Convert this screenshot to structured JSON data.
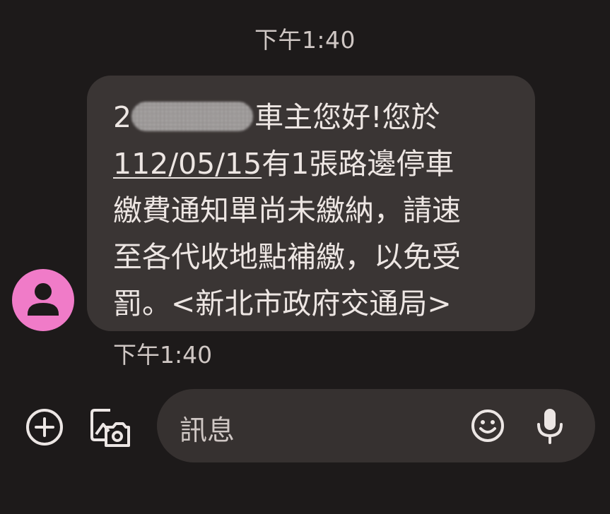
{
  "conversation": {
    "header_time": "下午1:40"
  },
  "contact": {
    "avatar_icon": "person-icon",
    "avatar_color": "#f07bc8"
  },
  "message": {
    "line1_prefix": "2",
    "line1_suffix": "車主您好!您於",
    "line2_link": "112/05/15",
    "line2_rest": "有1張路邊停車",
    "line3": "繳費通知單尚未繳納，請速",
    "line4": "至各代收地點補繳，以免受",
    "line5": "罰。<新北市政府交通局>",
    "time": "下午1:40"
  },
  "compose": {
    "placeholder": "訊息",
    "add_icon": "add-circle-icon",
    "gallery_icon": "gallery-icon",
    "emoji_icon": "emoji-icon",
    "mic_icon": "microphone-icon"
  },
  "colors": {
    "background": "#1d1a1a",
    "bubble": "#3a3534",
    "compose_bar": "#363130",
    "text": "#ede6e3",
    "muted_text": "#cfc7c4"
  }
}
